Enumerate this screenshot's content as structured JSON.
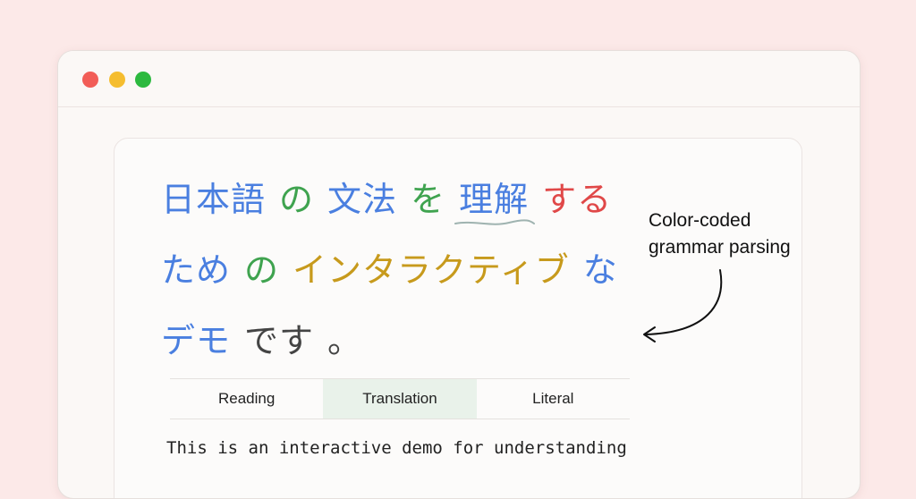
{
  "colors": {
    "noun": "#4a7fe0",
    "particle": "#3fa34f",
    "verb": "#e04848",
    "katakana": "#c79a1c",
    "copula": "#444444",
    "squiggle": "#9fb3b0",
    "window_close": "#f25d57",
    "window_minimize": "#f5bd2f",
    "window_maximize": "#2cb93f"
  },
  "sentence": {
    "line1": [
      {
        "text": "日本語",
        "pos": "noun"
      },
      {
        "text": "の",
        "pos": "particle"
      },
      {
        "text": "文法",
        "pos": "noun"
      },
      {
        "text": "を",
        "pos": "particle"
      },
      {
        "text": "理解",
        "pos": "noun"
      },
      {
        "text": "する",
        "pos": "verb"
      }
    ],
    "line2": [
      {
        "text": "ため",
        "pos": "noun"
      },
      {
        "text": "の",
        "pos": "particle"
      },
      {
        "text": "インタラクティブ",
        "pos": "katakana"
      },
      {
        "text": "な",
        "pos": "noun"
      }
    ],
    "line3": [
      {
        "text": "デモ",
        "pos": "noun"
      },
      {
        "text": "です",
        "pos": "copula"
      },
      {
        "text": "。",
        "pos": "copula"
      }
    ]
  },
  "tabs": [
    {
      "label": "Reading",
      "active": false
    },
    {
      "label": "Translation",
      "active": true
    },
    {
      "label": "Literal",
      "active": false
    }
  ],
  "translation_text": "This is an interactive demo for understanding",
  "annotation": {
    "line1": "Color-coded",
    "line2": "grammar parsing"
  }
}
